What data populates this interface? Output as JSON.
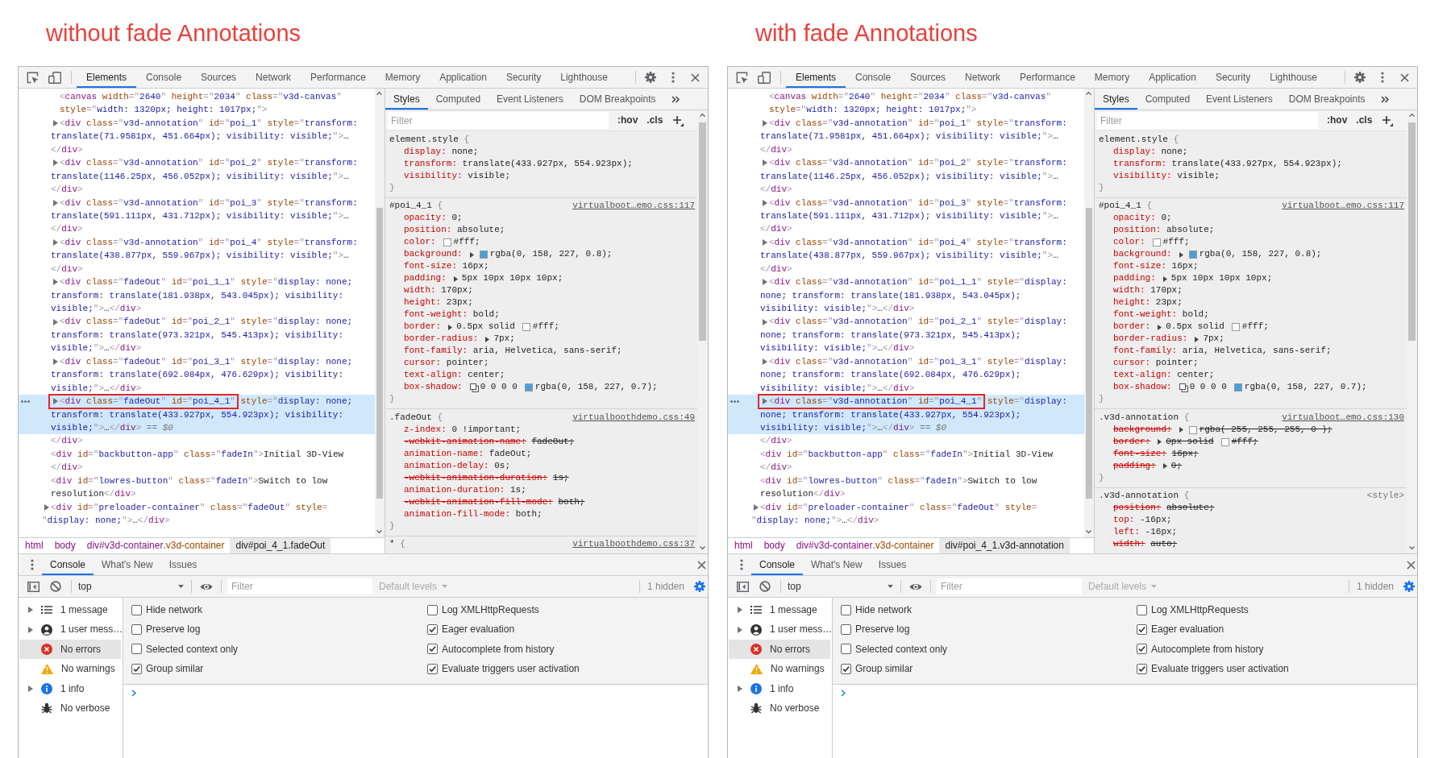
{
  "panels": [
    {
      "heading": "without fade Annotations",
      "toolbar": {
        "tabs": [
          {
            "label": "Elements",
            "selected": true
          },
          {
            "label": "Console",
            "selected": false
          },
          {
            "label": "Sources",
            "selected": false
          },
          {
            "label": "Network",
            "selected": false
          },
          {
            "label": "Performance",
            "selected": false
          },
          {
            "label": "Memory",
            "selected": false
          },
          {
            "label": "Application",
            "selected": false
          },
          {
            "label": "Security",
            "selected": false
          },
          {
            "label": "Lighthouse",
            "selected": false
          }
        ]
      },
      "elements": {
        "nodes": [
          {
            "selected": false,
            "children": [
              {
                "selected": false,
                "rows": [
                  "<canvas width=\"2640\" height=\"2034\" class=\"v3d-canvas\"",
                  "style=\"width: 1320px; height: 1017px;\">"
                ]
              },
              {
                "expanded": false,
                "selected": false,
                "rows": [
                  "<div class=\"v3d-annotation\" id=\"poi_1\" style=\"transform:",
                  "translate(71.9581px, 451.664px); visibility: visible;\">…",
                  "</div>"
                ]
              },
              {
                "expanded": false,
                "selected": false,
                "rows": [
                  "<div class=\"v3d-annotation\" id=\"poi_2\" style=\"transform:",
                  "translate(1146.25px, 456.052px); visibility: visible;\">…",
                  "</div>"
                ]
              },
              {
                "expanded": false,
                "selected": false,
                "rows": [
                  "<div class=\"v3d-annotation\" id=\"poi_3\" style=\"transform:",
                  "translate(591.111px, 431.712px); visibility: visible;\">…",
                  "</div>"
                ]
              },
              {
                "expanded": false,
                "selected": false,
                "rows": [
                  "<div class=\"v3d-annotation\" id=\"poi_4\" style=\"transform:",
                  "translate(438.877px, 559.967px); visibility: visible;\">…",
                  "</div>"
                ]
              },
              {
                "expanded": false,
                "selected": false,
                "rows": [
                  "<div class=\"fadeOut\" id=\"poi_1_1\" style=\"display: none;",
                  "transform: translate(181.938px, 543.045px); visibility:",
                  "visible;\">…</div>"
                ]
              },
              {
                "expanded": false,
                "selected": false,
                "rows": [
                  "<div class=\"fadeOut\" id=\"poi_2_1\" style=\"display: none;",
                  "transform: translate(973.321px, 545.413px); visibility:",
                  "visible;\">…</div>"
                ]
              },
              {
                "expanded": false,
                "selected": false,
                "rows": [
                  "<div class=\"fadeOut\" id=\"poi_3_1\" style=\"display: none;",
                  "transform: translate(692.084px, 476.629px); visibility:",
                  "visible;\">…</div>"
                ]
              },
              {
                "expanded": false,
                "selected": true,
                "annotated_prefix": "<div class=\"fadeOut\" id=\"poi_4_1\"",
                "rows": [
                  " style=\"display: none;",
                  "transform: translate(433.927px, 554.923px); visibility:",
                  "visible;\">…</div>"
                ],
                "console_ref": "== $0"
              }
            ],
            "closing": "</div>"
          },
          {
            "selected": false,
            "rows": [
              "<div id=\"backbutton-app\" class=\"fadeIn\">Initial 3D-View",
              "</div>"
            ]
          },
          {
            "selected": false,
            "rows": [
              "<div id=\"lowres-button\" class=\"fadeIn\">Switch to low",
              "resolution</div>"
            ]
          },
          {
            "expanded": false,
            "selected": false,
            "rows": [
              "<div id=\"preloader-container\" class=\"fadeOut\" style=",
              "\"display: none;\">…</div>"
            ]
          }
        ],
        "breadcrumbs": [
          {
            "selector": "html",
            "selected": false
          },
          {
            "selector": "body",
            "selected": false
          },
          {
            "selector": "div#v3d-container",
            "class_suffix": ".v3d-container",
            "selected": false
          },
          {
            "selector": "div#poi_4_1",
            "class_suffix": ".fadeOut",
            "selected": true
          }
        ]
      },
      "styles": {
        "tabs": [
          {
            "label": "Styles",
            "selected": true
          },
          {
            "label": "Computed",
            "selected": false
          },
          {
            "label": "Event Listeners",
            "selected": false
          },
          {
            "label": "DOM Breakpoints",
            "selected": false
          }
        ],
        "filter": {
          "placeholder": "Filter"
        },
        "buttons": [
          ":hov",
          ".cls"
        ],
        "rules": [
          {
            "selector": "element.style",
            "open": "{",
            "close": "}",
            "properties": [
              {
                "name": "display:",
                "overridden": false,
                "value": [
                  {
                    "kind": "text",
                    "text": "none;"
                  }
                ]
              },
              {
                "name": "transform:",
                "overridden": false,
                "value": [
                  {
                    "kind": "text",
                    "text": "translate(433.927px, 554.923px);"
                  }
                ]
              },
              {
                "name": "visibility:",
                "overridden": false,
                "value": [
                  {
                    "kind": "text",
                    "text": "visible;"
                  }
                ]
              }
            ]
          },
          {
            "selector": "#poi_4_1",
            "open": "{",
            "close": "}",
            "source": "virtualboot…emo.css:117",
            "source_linked": true,
            "properties": [
              {
                "name": "opacity:",
                "overridden": false,
                "value": [
                  {
                    "kind": "text",
                    "text": "0;"
                  }
                ]
              },
              {
                "name": "position:",
                "overridden": false,
                "value": [
                  {
                    "kind": "text",
                    "text": "absolute;"
                  }
                ]
              },
              {
                "name": "color:",
                "overridden": false,
                "value": [
                  {
                    "kind": "swatch",
                    "color": "#ffffff"
                  },
                  {
                    "kind": "text",
                    "text": "#fff;"
                  }
                ]
              },
              {
                "name": "background:",
                "overridden": false,
                "value": [
                  {
                    "kind": "expander",
                    "expanded": false
                  },
                  {
                    "kind": "swatch",
                    "color": "#4a9fd9"
                  },
                  {
                    "kind": "text",
                    "text": "rgba(0, 158, 227, 0.8);"
                  }
                ]
              },
              {
                "name": "font-size:",
                "overridden": false,
                "value": [
                  {
                    "kind": "text",
                    "text": "16px;"
                  }
                ]
              },
              {
                "name": "padding:",
                "overridden": false,
                "value": [
                  {
                    "kind": "expander",
                    "expanded": false
                  },
                  {
                    "kind": "text",
                    "text": "5px 10px 10px 10px;"
                  }
                ]
              },
              {
                "name": "width:",
                "overridden": false,
                "value": [
                  {
                    "kind": "text",
                    "text": "170px;"
                  }
                ]
              },
              {
                "name": "height:",
                "overridden": false,
                "value": [
                  {
                    "kind": "text",
                    "text": "23px;"
                  }
                ]
              },
              {
                "name": "font-weight:",
                "overridden": false,
                "value": [
                  {
                    "kind": "text",
                    "text": "bold;"
                  }
                ]
              },
              {
                "name": "border:",
                "overridden": false,
                "value": [
                  {
                    "kind": "expander",
                    "expanded": false
                  },
                  {
                    "kind": "text",
                    "text": "0.5px solid"
                  },
                  {
                    "kind": "swatch",
                    "color": "#ffffff"
                  },
                  {
                    "kind": "text",
                    "text": "#fff;"
                  }
                ]
              },
              {
                "name": "border-radius:",
                "overridden": false,
                "value": [
                  {
                    "kind": "expander",
                    "expanded": false
                  },
                  {
                    "kind": "text",
                    "text": "7px;"
                  }
                ]
              },
              {
                "name": "font-family:",
                "overridden": false,
                "value": [
                  {
                    "kind": "text",
                    "text": "aria, Helvetica, sans-serif;"
                  }
                ]
              },
              {
                "name": "cursor:",
                "overridden": false,
                "value": [
                  {
                    "kind": "text",
                    "text": "pointer;"
                  }
                ]
              },
              {
                "name": "text-align:",
                "overridden": false,
                "value": [
                  {
                    "kind": "text",
                    "text": "center;"
                  }
                ]
              },
              {
                "name": "box-shadow:",
                "overridden": false,
                "value": [
                  {
                    "kind": "shadow-editor"
                  },
                  {
                    "kind": "text",
                    "text": "0 0 0 0"
                  },
                  {
                    "kind": "swatch",
                    "color": "#4a9fd9"
                  },
                  {
                    "kind": "text",
                    "text": "rgba(0, 158, 227, 0.7);"
                  }
                ]
              }
            ]
          },
          {
            "selector": ".fadeOut",
            "open": "{",
            "close": "}",
            "source": "virtualboothdemo.css:49",
            "source_linked": true,
            "properties": [
              {
                "name": "z-index:",
                "overridden": false,
                "value": [
                  {
                    "kind": "text",
                    "text": "0 !important;"
                  }
                ]
              },
              {
                "name": "-webkit-animation-name:",
                "overridden": true,
                "value": [
                  {
                    "kind": "text",
                    "text": "fadeOut;"
                  }
                ]
              },
              {
                "name": "animation-name:",
                "overridden": false,
                "value": [
                  {
                    "kind": "text",
                    "text": "fadeOut;"
                  }
                ]
              },
              {
                "name": "animation-delay:",
                "overridden": false,
                "value": [
                  {
                    "kind": "text",
                    "text": "0s;"
                  }
                ]
              },
              {
                "name": "-webkit-animation-duration:",
                "overridden": true,
                "value": [
                  {
                    "kind": "text",
                    "text": "1s;"
                  }
                ]
              },
              {
                "name": "animation-duration:",
                "overridden": false,
                "value": [
                  {
                    "kind": "text",
                    "text": "1s;"
                  }
                ]
              },
              {
                "name": "-webkit-animation-fill-mode:",
                "overridden": true,
                "value": [
                  {
                    "kind": "text",
                    "text": "both;"
                  }
                ]
              },
              {
                "name": "animation-fill-mode:",
                "overridden": false,
                "value": [
                  {
                    "kind": "text",
                    "text": "both;"
                  }
                ]
              }
            ]
          },
          {
            "selector": "*",
            "open": "{",
            "source": "virtualboothdemo.css:37",
            "source_linked": true
          }
        ]
      },
      "drawer": {
        "tabs": [
          {
            "label": "Console",
            "selected": true
          },
          {
            "label": "What's New",
            "selected": false
          },
          {
            "label": "Issues",
            "selected": false
          }
        ],
        "context": "top",
        "filter": {
          "placeholder": "Filter"
        },
        "levels": {
          "label": "Default levels",
          "disabled": true
        },
        "hidden": "1 hidden",
        "settings_open": true,
        "sidebar": [
          {
            "kind": "messages",
            "label": "1 message",
            "expanded": false,
            "selected": false
          },
          {
            "kind": "user",
            "label": "1 user mess…",
            "expanded": false,
            "selected": false
          },
          {
            "kind": "error",
            "label": "No errors",
            "selected": true
          },
          {
            "kind": "warning",
            "label": "No warnings",
            "selected": false
          },
          {
            "kind": "info",
            "label": "1 info",
            "expanded": false,
            "selected": false
          },
          {
            "kind": "verbose",
            "label": "No verbose",
            "selected": false
          }
        ],
        "settings": [
          {
            "label": "Hide network",
            "checked": false
          },
          {
            "label": "Log XMLHttpRequests",
            "checked": false
          },
          {
            "label": "Preserve log",
            "checked": false
          },
          {
            "label": "Eager evaluation",
            "checked": true
          },
          {
            "label": "Selected context only",
            "checked": false
          },
          {
            "label": "Autocomplete from history",
            "checked": true
          },
          {
            "label": "Group similar",
            "checked": true
          },
          {
            "label": "Evaluate triggers user activation",
            "checked": true
          }
        ]
      }
    },
    {
      "heading": "with fade Annotations",
      "toolbar": {
        "tabs": [
          {
            "label": "Elements",
            "selected": true
          },
          {
            "label": "Console",
            "selected": false
          },
          {
            "label": "Sources",
            "selected": false
          },
          {
            "label": "Network",
            "selected": false
          },
          {
            "label": "Performance",
            "selected": false
          },
          {
            "label": "Memory",
            "selected": false
          },
          {
            "label": "Application",
            "selected": false
          },
          {
            "label": "Security",
            "selected": false
          },
          {
            "label": "Lighthouse",
            "selected": false
          }
        ]
      },
      "elements": {
        "nodes": [
          {
            "selected": false,
            "children": [
              {
                "selected": false,
                "rows": [
                  "<canvas width=\"2640\" height=\"2034\" class=\"v3d-canvas\"",
                  "style=\"width: 1320px; height: 1017px;\">"
                ]
              },
              {
                "expanded": false,
                "selected": false,
                "rows": [
                  "<div class=\"v3d-annotation\" id=\"poi_1\" style=\"transform:",
                  "translate(71.9581px, 451.664px); visibility: visible;\">…",
                  "</div>"
                ]
              },
              {
                "expanded": false,
                "selected": false,
                "rows": [
                  "<div class=\"v3d-annotation\" id=\"poi_2\" style=\"transform:",
                  "translate(1146.25px, 456.052px); visibility: visible;\">…",
                  "</div>"
                ]
              },
              {
                "expanded": false,
                "selected": false,
                "rows": [
                  "<div class=\"v3d-annotation\" id=\"poi_3\" style=\"transform:",
                  "translate(591.111px, 431.712px); visibility: visible;\">…",
                  "</div>"
                ]
              },
              {
                "expanded": false,
                "selected": false,
                "rows": [
                  "<div class=\"v3d-annotation\" id=\"poi_4\" style=\"transform:",
                  "translate(438.877px, 559.967px); visibility: visible;\">…",
                  "</div>"
                ]
              },
              {
                "expanded": false,
                "selected": false,
                "rows": [
                  "<div class=\"v3d-annotation\" id=\"poi_1_1\" style=\"display:",
                  "none; transform: translate(181.938px, 543.045px);",
                  "visibility: visible;\">…</div>"
                ]
              },
              {
                "expanded": false,
                "selected": false,
                "rows": [
                  "<div class=\"v3d-annotation\" id=\"poi_2_1\" style=\"display:",
                  "none; transform: translate(973.321px, 545.413px);",
                  "visibility: visible;\">…</div>"
                ]
              },
              {
                "expanded": false,
                "selected": false,
                "rows": [
                  "<div class=\"v3d-annotation\" id=\"poi_3_1\" style=\"display:",
                  "none; transform: translate(692.084px, 476.629px);",
                  "visibility: visible;\">…</div>"
                ]
              },
              {
                "expanded": false,
                "selected": true,
                "annotated_prefix": "<div class=\"v3d-annotation\" id=\"poi_4_1\"",
                "rows": [
                  " style=\"display:",
                  "none; transform: translate(433.927px, 554.923px);",
                  "visibility: visible;\">…</div>"
                ],
                "console_ref": "== $0"
              }
            ],
            "closing": "</div>"
          },
          {
            "selected": false,
            "rows": [
              "<div id=\"backbutton-app\" class=\"fadeIn\">Initial 3D-View",
              "</div>"
            ]
          },
          {
            "selected": false,
            "rows": [
              "<div id=\"lowres-button\" class=\"fadeIn\">Switch to low",
              "resolution</div>"
            ]
          },
          {
            "expanded": false,
            "selected": false,
            "rows": [
              "<div id=\"preloader-container\" class=\"fadeOut\" style=",
              "\"display: none;\">…</div>"
            ]
          }
        ],
        "breadcrumbs": [
          {
            "selector": "html",
            "selected": false
          },
          {
            "selector": "body",
            "selected": false
          },
          {
            "selector": "div#v3d-container",
            "class_suffix": ".v3d-container",
            "selected": false
          },
          {
            "selector": "div#poi_4_1",
            "class_suffix": ".v3d-annotation",
            "selected": true
          }
        ]
      },
      "styles": {
        "tabs": [
          {
            "label": "Styles",
            "selected": true
          },
          {
            "label": "Computed",
            "selected": false
          },
          {
            "label": "Event Listeners",
            "selected": false
          },
          {
            "label": "DOM Breakpoints",
            "selected": false
          }
        ],
        "filter": {
          "placeholder": "Filter"
        },
        "buttons": [
          ":hov",
          ".cls"
        ],
        "rules": [
          {
            "selector": "element.style",
            "open": "{",
            "close": "}",
            "properties": [
              {
                "name": "display:",
                "overridden": false,
                "value": [
                  {
                    "kind": "text",
                    "text": "none;"
                  }
                ]
              },
              {
                "name": "transform:",
                "overridden": false,
                "value": [
                  {
                    "kind": "text",
                    "text": "translate(433.927px, 554.923px);"
                  }
                ]
              },
              {
                "name": "visibility:",
                "overridden": false,
                "value": [
                  {
                    "kind": "text",
                    "text": "visible;"
                  }
                ]
              }
            ]
          },
          {
            "selector": "#poi_4_1",
            "open": "{",
            "close": "}",
            "source": "virtualboot…emo.css:117",
            "source_linked": true,
            "properties": [
              {
                "name": "opacity:",
                "overridden": false,
                "value": [
                  {
                    "kind": "text",
                    "text": "0;"
                  }
                ]
              },
              {
                "name": "position:",
                "overridden": false,
                "value": [
                  {
                    "kind": "text",
                    "text": "absolute;"
                  }
                ]
              },
              {
                "name": "color:",
                "overridden": false,
                "value": [
                  {
                    "kind": "swatch",
                    "color": "#ffffff"
                  },
                  {
                    "kind": "text",
                    "text": "#fff;"
                  }
                ]
              },
              {
                "name": "background:",
                "overridden": false,
                "value": [
                  {
                    "kind": "expander",
                    "expanded": false
                  },
                  {
                    "kind": "swatch",
                    "color": "#4a9fd9"
                  },
                  {
                    "kind": "text",
                    "text": "rgba(0, 158, 227, 0.8);"
                  }
                ]
              },
              {
                "name": "font-size:",
                "overridden": false,
                "value": [
                  {
                    "kind": "text",
                    "text": "16px;"
                  }
                ]
              },
              {
                "name": "padding:",
                "overridden": false,
                "value": [
                  {
                    "kind": "expander",
                    "expanded": false
                  },
                  {
                    "kind": "text",
                    "text": "5px 10px 10px 10px;"
                  }
                ]
              },
              {
                "name": "width:",
                "overridden": false,
                "value": [
                  {
                    "kind": "text",
                    "text": "170px;"
                  }
                ]
              },
              {
                "name": "height:",
                "overridden": false,
                "value": [
                  {
                    "kind": "text",
                    "text": "23px;"
                  }
                ]
              },
              {
                "name": "font-weight:",
                "overridden": false,
                "value": [
                  {
                    "kind": "text",
                    "text": "bold;"
                  }
                ]
              },
              {
                "name": "border:",
                "overridden": false,
                "value": [
                  {
                    "kind": "expander",
                    "expanded": false
                  },
                  {
                    "kind": "text",
                    "text": "0.5px solid"
                  },
                  {
                    "kind": "swatch",
                    "color": "#ffffff"
                  },
                  {
                    "kind": "text",
                    "text": "#fff;"
                  }
                ]
              },
              {
                "name": "border-radius:",
                "overridden": false,
                "value": [
                  {
                    "kind": "expander",
                    "expanded": false
                  },
                  {
                    "kind": "text",
                    "text": "7px;"
                  }
                ]
              },
              {
                "name": "font-family:",
                "overridden": false,
                "value": [
                  {
                    "kind": "text",
                    "text": "aria, Helvetica, sans-serif;"
                  }
                ]
              },
              {
                "name": "cursor:",
                "overridden": false,
                "value": [
                  {
                    "kind": "text",
                    "text": "pointer;"
                  }
                ]
              },
              {
                "name": "text-align:",
                "overridden": false,
                "value": [
                  {
                    "kind": "text",
                    "text": "center;"
                  }
                ]
              },
              {
                "name": "box-shadow:",
                "overridden": false,
                "value": [
                  {
                    "kind": "shadow-editor"
                  },
                  {
                    "kind": "text",
                    "text": "0 0 0 0"
                  },
                  {
                    "kind": "swatch",
                    "color": "#4a9fd9"
                  },
                  {
                    "kind": "text",
                    "text": "rgba(0, 158, 227, 0.7);"
                  }
                ]
              }
            ]
          },
          {
            "selector": ".v3d-annotation",
            "open": "{",
            "close": "}",
            "source": "virtualboot…emo.css:130",
            "source_linked": true,
            "properties": [
              {
                "name": "background:",
                "overridden": true,
                "value": [
                  {
                    "kind": "expander",
                    "expanded": false
                  },
                  {
                    "kind": "swatch",
                    "color": "#ffffff"
                  },
                  {
                    "kind": "text",
                    "text": "rgba( 255, 255, 255, 0 );"
                  }
                ]
              },
              {
                "name": "border:",
                "overridden": true,
                "value": [
                  {
                    "kind": "expander",
                    "expanded": false
                  },
                  {
                    "kind": "text",
                    "text": "0px solid"
                  },
                  {
                    "kind": "swatch",
                    "color": "#ffffff"
                  },
                  {
                    "kind": "text",
                    "text": "#fff;"
                  }
                ]
              },
              {
                "name": "font-size:",
                "overridden": true,
                "value": [
                  {
                    "kind": "text",
                    "text": "16px;"
                  }
                ]
              },
              {
                "name": "padding:",
                "overridden": true,
                "value": [
                  {
                    "kind": "expander",
                    "expanded": false
                  },
                  {
                    "kind": "text",
                    "text": "0;"
                  }
                ]
              }
            ]
          },
          {
            "selector": ".v3d-annotation",
            "open": "{",
            "source": "<style>",
            "source_linked": false,
            "properties": [
              {
                "name": "position:",
                "overridden": true,
                "value": [
                  {
                    "kind": "text",
                    "text": "absolute;"
                  }
                ]
              },
              {
                "name": "top:",
                "overridden": false,
                "value": [
                  {
                    "kind": "text",
                    "text": "-16px;"
                  }
                ]
              },
              {
                "name": "left:",
                "overridden": false,
                "value": [
                  {
                    "kind": "text",
                    "text": "-16px;"
                  }
                ]
              },
              {
                "name": "width:",
                "overridden": true,
                "value": [
                  {
                    "kind": "text",
                    "text": "auto;"
                  }
                ]
              }
            ]
          }
        ]
      },
      "drawer": {
        "tabs": [
          {
            "label": "Console",
            "selected": true
          },
          {
            "label": "What's New",
            "selected": false
          },
          {
            "label": "Issues",
            "selected": false
          }
        ],
        "context": "top",
        "filter": {
          "placeholder": "Filter"
        },
        "levels": {
          "label": "Default levels",
          "disabled": true
        },
        "hidden": "1 hidden",
        "settings_open": true,
        "sidebar": [
          {
            "kind": "messages",
            "label": "1 message",
            "expanded": false,
            "selected": false
          },
          {
            "kind": "user",
            "label": "1 user mess…",
            "expanded": false,
            "selected": false
          },
          {
            "kind": "error",
            "label": "No errors",
            "selected": true
          },
          {
            "kind": "warning",
            "label": "No warnings",
            "selected": false
          },
          {
            "kind": "info",
            "label": "1 info",
            "expanded": false,
            "selected": false
          },
          {
            "kind": "verbose",
            "label": "No verbose",
            "selected": false
          }
        ],
        "settings": [
          {
            "label": "Hide network",
            "checked": false
          },
          {
            "label": "Log XMLHttpRequests",
            "checked": false
          },
          {
            "label": "Preserve log",
            "checked": false
          },
          {
            "label": "Eager evaluation",
            "checked": true
          },
          {
            "label": "Selected context only",
            "checked": false
          },
          {
            "label": "Autocomplete from history",
            "checked": true
          },
          {
            "label": "Group similar",
            "checked": true
          },
          {
            "label": "Evaluate triggers user activation",
            "checked": true
          }
        ]
      }
    }
  ]
}
